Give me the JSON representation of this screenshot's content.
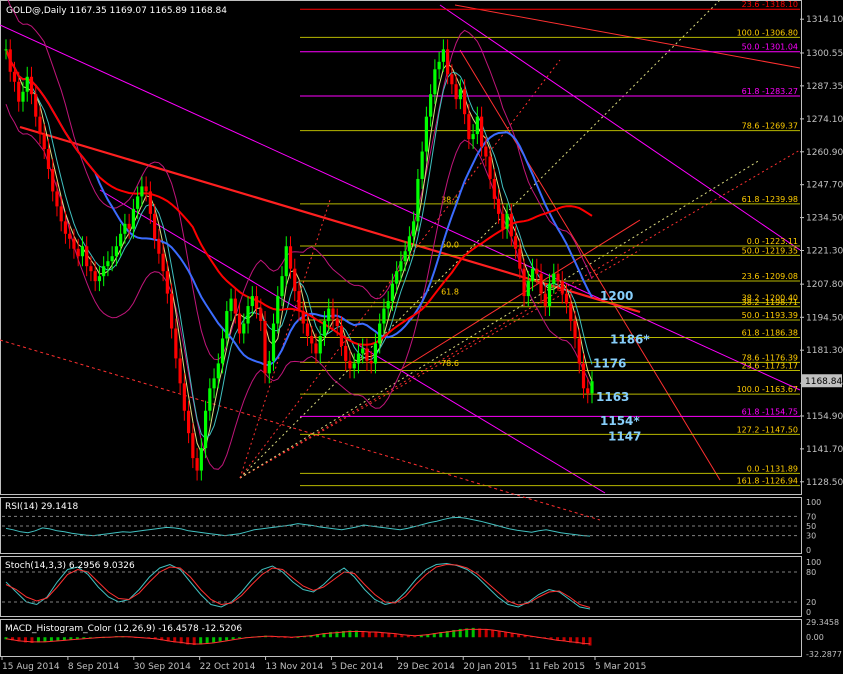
{
  "chart_data": {
    "type": "candlestick",
    "colors": {
      "background": "#000000",
      "frame": "#c0c0c0",
      "grid": "#4a4a4a",
      "candle": "#00ff00",
      "ma_red": "#ff0000",
      "ma_blue": "#3b6cff",
      "bands": "#c0157a",
      "fib": "#b8b800",
      "fib_text": "#ffcc00",
      "target": "#87cefa",
      "diag": "#ff3030",
      "cyan": "#40c0c0",
      "magenta": "#ff00ff",
      "pale": "#dcdc80"
    },
    "main": {
      "title": "GOLD@,Daily  1167.35 1169.07 1165.89 1168.84",
      "y_ticks": [
        "1314.10",
        "1300.55",
        "1287.35",
        "1274.10",
        "1260.90",
        "1247.70",
        "1234.50",
        "1221.30",
        "1207.80",
        "1194.50",
        "1181.30",
        "1168.05",
        "1154.90",
        "1141.70",
        "1128.50"
      ],
      "ylim": [
        1124.0,
        1321.0
      ],
      "current_price": "1168.84",
      "close_series": [
        1302,
        1293,
        1289,
        1281,
        1285,
        1291,
        1284,
        1275,
        1268,
        1262,
        1254,
        1245,
        1239,
        1233,
        1228,
        1226,
        1222,
        1219,
        1223,
        1215,
        1213,
        1209,
        1211,
        1215,
        1217,
        1219,
        1223,
        1228,
        1232,
        1230,
        1238,
        1243,
        1247,
        1245,
        1236,
        1226,
        1220,
        1213,
        1204,
        1190,
        1178,
        1168,
        1157,
        1148,
        1138,
        1133,
        1142,
        1157,
        1166,
        1170,
        1176,
        1186,
        1197,
        1202,
        1196,
        1188,
        1192,
        1199,
        1203,
        1198,
        1193,
        1172,
        1177,
        1192,
        1203,
        1211,
        1223,
        1214,
        1205,
        1197,
        1192,
        1187,
        1184,
        1180,
        1187,
        1193,
        1198,
        1194,
        1191,
        1183,
        1177,
        1174,
        1176,
        1180,
        1182,
        1177,
        1176,
        1184,
        1192,
        1198,
        1201,
        1208,
        1213,
        1217,
        1221,
        1227,
        1233,
        1250,
        1261,
        1275,
        1284,
        1294,
        1297,
        1302,
        1292,
        1288,
        1282,
        1286,
        1276,
        1266,
        1268,
        1275,
        1263,
        1259,
        1250,
        1242,
        1236,
        1230,
        1236,
        1227,
        1222,
        1214,
        1203,
        1209,
        1214,
        1212,
        1204,
        1199,
        1208,
        1212,
        1209,
        1204,
        1200,
        1193,
        1186,
        1176,
        1166,
        1164,
        1168.84
      ],
      "fib_levels": [
        {
          "label": "23.6 -1318.10",
          "price": 1318.1,
          "color": "#ff0000"
        },
        {
          "label": "100.0 -1306.80",
          "price": 1306.8,
          "color": "#b8b800"
        },
        {
          "label": "50.0 -1301.04",
          "price": 1301.04,
          "color": "#ff00ff"
        },
        {
          "label": "61.8 -1283.27",
          "price": 1283.27,
          "color": "#ff00ff"
        },
        {
          "label": "78.6 -1269.37",
          "price": 1269.37,
          "color": "#b8b800"
        },
        {
          "label": "61.8 -1239.98",
          "price": 1239.98,
          "color": "#b8b800"
        },
        {
          "label": "0.0 -1223.11",
          "price": 1223.11,
          "color": "#b8b800"
        },
        {
          "label": "50.0 -1219.35",
          "price": 1219.35,
          "color": "#b8b800"
        },
        {
          "label": "23.6 -1209.08",
          "price": 1209.08,
          "color": "#b8b800"
        },
        {
          "label": "38.2 -1200.40",
          "price": 1200.4,
          "color": "#b8b800"
        },
        {
          "label": "38.2 -1198.71",
          "price": 1198.71,
          "color": "#b8b800"
        },
        {
          "label": "50.0 -1193.39",
          "price": 1193.39,
          "color": "#b8b800"
        },
        {
          "label": "61.8 -1186.38",
          "price": 1186.38,
          "color": "#b8b800"
        },
        {
          "label": "78.6 -1176.39",
          "price": 1176.39,
          "color": "#b8b800"
        },
        {
          "label": "23.6 -1173.17",
          "price": 1173.17,
          "color": "#b8b800"
        },
        {
          "label": "100.0 -1163.67",
          "price": 1163.67,
          "color": "#b8b800"
        },
        {
          "label": "61.8 -1154.75",
          "price": 1154.75,
          "color": "#ff00ff"
        },
        {
          "label": "127.2 -1147.50",
          "price": 1147.5,
          "color": "#b8b800"
        },
        {
          "label": "0.0 -1131.89",
          "price": 1131.89,
          "color": "#b8b800"
        },
        {
          "label": "161.8 -1126.94",
          "price": 1126.94,
          "color": "#b8b800"
        }
      ],
      "inner_fib_labels": [
        {
          "label": "38.2",
          "price": 1240.5
        },
        {
          "label": "50.0",
          "price": 1222.4
        },
        {
          "label": "61.8",
          "price": 1203.6
        },
        {
          "label": "78.6",
          "price": 1175.0
        }
      ],
      "targets": [
        {
          "label": "1200",
          "price": 1203.5
        },
        {
          "label": "1186*",
          "price": 1186.0
        },
        {
          "label": "1176",
          "price": 1176.3
        },
        {
          "label": "1163",
          "price": 1163.0
        },
        {
          "label": "1154*",
          "price": 1153.3
        },
        {
          "label": "1147",
          "price": 1147.0
        }
      ]
    },
    "x_labels": [
      "15 Aug 2014",
      "8 Sep 2014",
      "30 Sep 2014",
      "22 Oct 2014",
      "13 Nov 2014",
      "5 Dec 2014",
      "29 Dec 2014",
      "20 Jan 2015",
      "11 Feb 2015",
      "5 Mar 2015"
    ],
    "rsi": {
      "title": "RSI(14) 29.1418",
      "levels": [
        "100",
        "70",
        "50",
        "30",
        "0"
      ],
      "values": [
        45,
        42,
        38,
        36,
        40,
        46,
        44,
        40,
        38,
        35,
        33,
        31,
        30,
        32,
        34,
        36,
        38,
        37,
        39,
        41,
        43,
        45,
        47,
        46,
        44,
        40,
        38,
        36,
        34,
        32,
        30,
        32,
        34,
        38,
        42,
        44,
        46,
        48,
        50,
        52,
        55,
        53,
        51,
        48,
        46,
        44,
        42,
        45,
        48,
        52,
        50,
        48,
        46,
        44,
        42,
        45,
        49,
        53,
        57,
        60,
        64,
        67,
        68,
        66,
        63,
        60,
        56,
        52,
        48,
        44,
        41,
        39,
        37,
        40,
        42,
        39,
        36,
        34,
        32,
        30,
        29
      ]
    },
    "stoch": {
      "title": "Stoch(14,3,3) 6.2956 9.0326",
      "levels": [
        "100",
        "80",
        "20",
        "0"
      ],
      "k": [
        60,
        40,
        20,
        15,
        30,
        60,
        85,
        90,
        75,
        50,
        30,
        20,
        25,
        45,
        70,
        88,
        95,
        85,
        60,
        35,
        15,
        10,
        20,
        40,
        65,
        85,
        92,
        80,
        60,
        45,
        40,
        55,
        75,
        88,
        70,
        45,
        25,
        15,
        20,
        40,
        65,
        85,
        95,
        97,
        93,
        85,
        70,
        50,
        30,
        15,
        10,
        20,
        35,
        45,
        40,
        25,
        10,
        6
      ],
      "d": [
        55,
        45,
        30,
        22,
        28,
        50,
        75,
        85,
        80,
        60,
        40,
        27,
        25,
        38,
        60,
        80,
        90,
        88,
        70,
        45,
        25,
        15,
        18,
        33,
        55,
        75,
        88,
        85,
        68,
        52,
        43,
        50,
        65,
        80,
        77,
        55,
        35,
        20,
        18,
        32,
        55,
        75,
        90,
        95,
        94,
        88,
        76,
        58,
        40,
        22,
        14,
        18,
        30,
        40,
        42,
        30,
        15,
        9
      ]
    },
    "macd": {
      "title": "MACD_Histogram_Color (12,26,9) -16.4578 -12.5206",
      "ticks": [
        "29.3458",
        "0.00",
        "-32.2877"
      ],
      "hist": [
        -4,
        -6,
        -8,
        -10,
        -11,
        -10,
        -9,
        -8,
        -7,
        -6,
        -5,
        -4,
        -3,
        -2,
        -1,
        0,
        1,
        2,
        2,
        1,
        0,
        -1,
        -2,
        -4,
        -6,
        -8,
        -10,
        -12,
        -14,
        -15,
        -14,
        -12,
        -10,
        -8,
        -6,
        -4,
        -2,
        0,
        1,
        2,
        3,
        2,
        1,
        0,
        -1,
        0,
        2,
        4,
        6,
        8,
        10,
        11,
        12,
        13,
        13,
        12,
        11,
        10,
        9,
        8,
        6,
        4,
        3,
        2,
        4,
        6,
        8,
        10,
        12,
        14,
        16,
        17,
        18,
        17,
        16,
        14,
        12,
        10,
        8,
        6,
        4,
        2,
        0,
        -2,
        -4,
        -6,
        -8,
        -10,
        -12,
        -14,
        -16
      ],
      "signal": [
        -3,
        -5,
        -7,
        -8,
        -9,
        -9,
        -9,
        -8,
        -7,
        -6,
        -5,
        -4,
        -3,
        -2,
        -1,
        0,
        0,
        1,
        1,
        1,
        0,
        -1,
        -2,
        -3,
        -5,
        -7,
        -9,
        -10,
        -12,
        -13,
        -13,
        -12,
        -11,
        -9,
        -7,
        -5,
        -3,
        -1,
        0,
        1,
        2,
        2,
        1,
        1,
        0,
        1,
        2,
        3,
        5,
        7,
        8,
        9,
        10,
        11,
        11,
        11,
        10,
        10,
        9,
        8,
        7,
        5,
        4,
        3,
        4,
        5,
        7,
        9,
        10,
        12,
        13,
        15,
        15,
        15,
        15,
        14,
        12,
        10,
        8,
        6,
        4,
        2,
        0,
        -2,
        -4,
        -6,
        -7,
        -9,
        -10,
        -12,
        -12.5
      ]
    }
  }
}
